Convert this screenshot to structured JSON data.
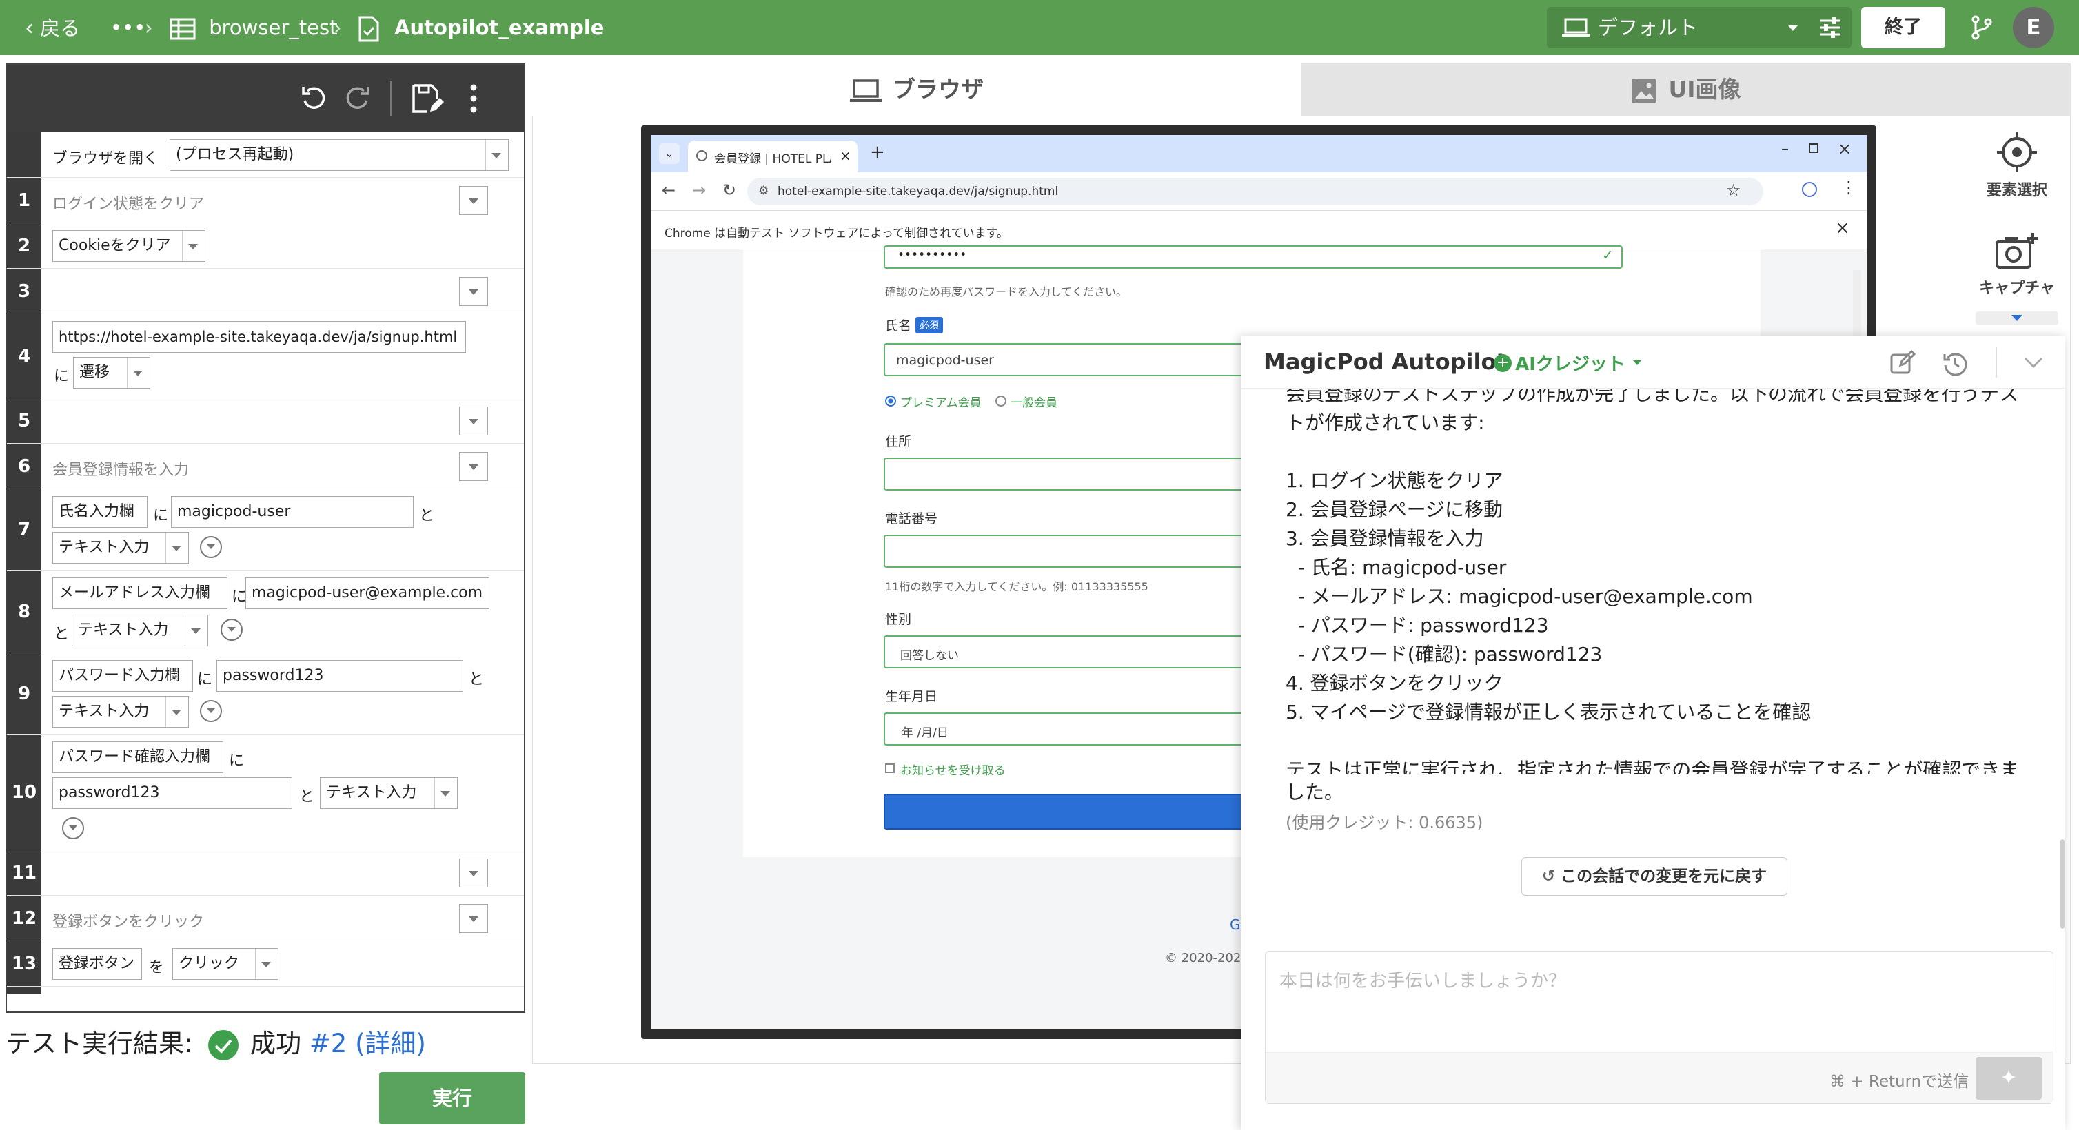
{
  "topbar": {
    "back": "戻る",
    "more": "•••",
    "project": "browser_test",
    "test": "Autopilot_example",
    "device": "デフォルト",
    "end": "終了",
    "avatar": "E"
  },
  "steps": {
    "s0": {
      "cmd": "ブラウザを開く",
      "opt": "(プロセス再起動)"
    },
    "s1": {
      "n": "1",
      "text": "ログイン状態をクリア"
    },
    "s2": {
      "n": "2",
      "text": "Cookieをクリア"
    },
    "s3": {
      "n": "3"
    },
    "s4": {
      "n": "4",
      "url": "https://hotel-example-site.takeyaqa.dev/ja/signup.html",
      "ni": "に",
      "action": "遷移"
    },
    "s5": {
      "n": "5"
    },
    "s6": {
      "n": "6",
      "text": "会員登録情報を入力"
    },
    "s7": {
      "n": "7",
      "el": "氏名入力欄",
      "ni": "に",
      "val": "magicpod-user",
      "to": "と",
      "action": "テキスト入力"
    },
    "s8": {
      "n": "8",
      "el": "メールアドレス入力欄",
      "ni": "に",
      "val": "magicpod-user@example.com",
      "to": "と",
      "action": "テキスト入力"
    },
    "s9": {
      "n": "9",
      "el": "パスワード入力欄",
      "ni": "に",
      "val": "password123",
      "to": "と",
      "action": "テキスト入力"
    },
    "s10": {
      "n": "10",
      "el": "パスワード確認入力欄",
      "ni": "に",
      "val": "password123",
      "to": "と",
      "action": "テキスト入力"
    },
    "s11": {
      "n": "11"
    },
    "s12": {
      "n": "12",
      "text": "登録ボタンをクリック"
    },
    "s13": {
      "n": "13",
      "el": "登録ボタン",
      "wo": "を",
      "action": "クリック"
    }
  },
  "result": {
    "label": "テスト実行結果:",
    "status": "成功",
    "run": "#2",
    "detail": "(詳細)"
  },
  "run_button": "実行",
  "tabs": {
    "browser": "ブラウザ",
    "ui": "UI画像"
  },
  "tools": {
    "select": "要素選択",
    "capture": "キャプチャ"
  },
  "browser": {
    "tab_title": "会員登録 | HOTEL PLANISPH",
    "url": "hotel-example-site.takeyaqa.dev/ja/signup.html",
    "banner": "Chrome は自動テスト ソフトウェアによって制御されています。",
    "page": {
      "pw_dots": "••••••••••",
      "confirm_hint": "確認のため再度パスワードを入力してください。",
      "name_label": "氏名",
      "required": "必須",
      "name_value": "magicpod-user",
      "premium": "プレミアム会員",
      "normal": "一般会員",
      "address": "住所",
      "phone": "電話番号",
      "phone_hint": "11桁の数字で入力してください。例: 01133335555",
      "gender": "性別",
      "gender_value": "回答しない",
      "birthday": "生年月日",
      "birthday_value": "年 /月/日",
      "notify": "お知らせを受け取る",
      "footer_g": "G",
      "copyright": "© 2020-202"
    }
  },
  "chat": {
    "title": "MagicPod Autopilot",
    "credit": "AIクレジット",
    "lines": [
      "会員登録のテストステップの作成が完了しました。以下の流れで会員登録を行うテス",
      "トが作成されています:",
      "1. ログイン状態をクリア",
      "2. 会員登録ページに移動",
      "3. 会員登録情報を入力",
      "  - 氏名: magicpod-user",
      "  - メールアドレス: magicpod-user@example.com",
      "  - パスワード: password123",
      "  - パスワード(確認): password123",
      "4. 登録ボタンをクリック",
      "5. マイページで登録情報が正しく表示されていることを確認",
      "テストは正常に実行され、指定された情報での会員登録が完了することが確認できま",
      "した。"
    ],
    "used_credit": "(使用クレジット: 0.6635)",
    "revert": "この会話での変更を元に戻す",
    "placeholder": "本日は何をお手伝いしましょうか？",
    "send_hint": "⌘ + Returnで送信"
  }
}
